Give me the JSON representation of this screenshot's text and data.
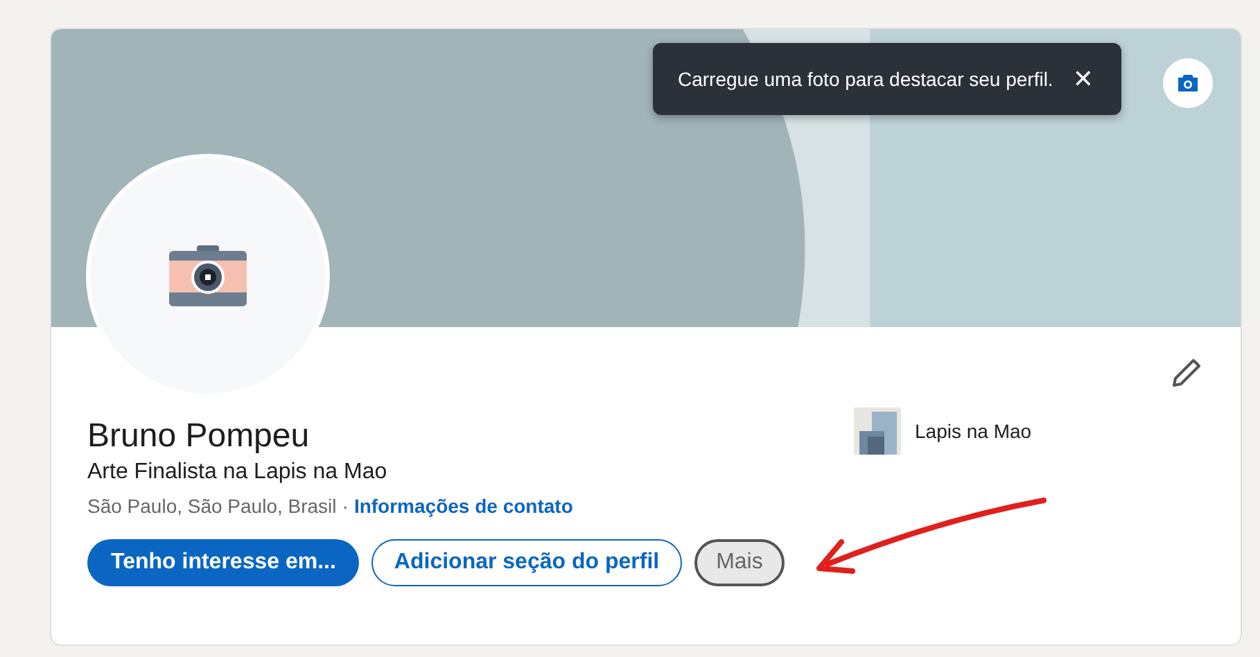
{
  "toast": {
    "message": "Carregue uma foto para destacar seu perfil.",
    "close": "✕"
  },
  "profile": {
    "name": "Bruno Pompeu",
    "headline": "Arte Finalista na Lapis na Mao",
    "location": "São Paulo, São Paulo, Brasil",
    "separator": "·",
    "contact_link": "Informações de contato"
  },
  "company": {
    "name": "Lapis na Mao"
  },
  "buttons": [
    {
      "label": "Tenho interesse em...",
      "kind": "primary",
      "highlighted": false
    },
    {
      "label": "Adicionar seção do perfil",
      "kind": "outline",
      "highlighted": false
    },
    {
      "label": "Mais",
      "kind": "muted",
      "highlighted": true
    }
  ]
}
